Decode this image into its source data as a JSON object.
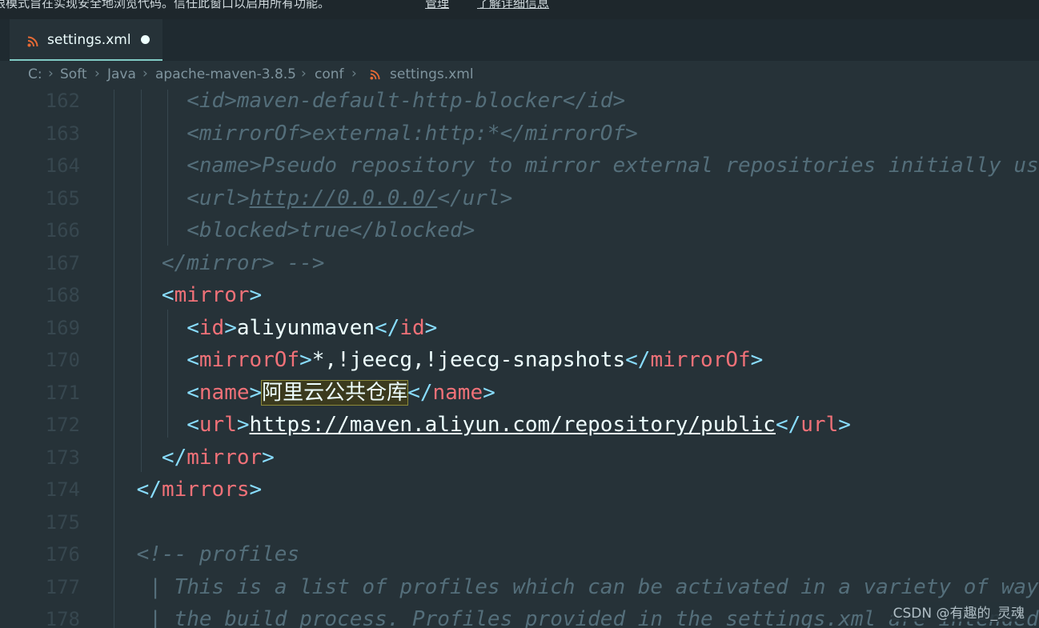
{
  "banner": {
    "message": "限模式旨在实现安全地浏览代码。信任此窗口以启用所有功能。",
    "manage_link": "管理",
    "learn_more_link": "了解详细信息"
  },
  "tab": {
    "icon": "rss-icon",
    "filename": "settings.xml",
    "modified_indicator": "unsaved-dot"
  },
  "breadcrumb": {
    "segments": [
      "C:",
      "Soft",
      "Java",
      "apache-maven-3.8.5",
      "conf",
      "settings.xml"
    ],
    "separator": "›"
  },
  "editor": {
    "line_numbers": [
      "162",
      "163",
      "164",
      "165",
      "166",
      "167",
      "168",
      "169",
      "170",
      "171",
      "172",
      "173",
      "174",
      "175",
      "176",
      "177",
      "178"
    ],
    "code": {
      "l162": {
        "indent": "        ",
        "text": "<id>maven-default-http-blocker</id>"
      },
      "l163": {
        "indent": "        ",
        "text": "<mirrorOf>external:http:*</mirrorOf>"
      },
      "l164": {
        "indent": "        ",
        "text": "<name>Pseudo repository to mirror external repositories initially using HTTP.</name>"
      },
      "l165": {
        "indent": "        ",
        "open": "<url>",
        "url": "http://0.0.0.0/",
        "close": "</url>"
      },
      "l166": {
        "indent": "        ",
        "text": "<blocked>true</blocked>"
      },
      "l167": {
        "indent": "      ",
        "text": "</mirror> -->"
      },
      "l168": {
        "indent": "      ",
        "lt": "<",
        "tag": "mirror",
        "gt": ">"
      },
      "l169": {
        "indent": "        ",
        "tag": "id",
        "value": "aliyunmaven"
      },
      "l170": {
        "indent": "        ",
        "tag": "mirrorOf",
        "value": "*,!jeecg,!jeecg-snapshots"
      },
      "l171": {
        "indent": "        ",
        "tag": "name",
        "value": "阿里云公共仓库"
      },
      "l172": {
        "indent": "        ",
        "tag": "url",
        "value": "https://maven.aliyun.com/repository/public"
      },
      "l173": {
        "indent": "      ",
        "lt": "</",
        "tag": "mirror",
        "gt": ">"
      },
      "l174": {
        "indent": "    ",
        "lt": "</",
        "tag": "mirrors",
        "gt": ">"
      },
      "l175": {
        "indent": "",
        "text": ""
      },
      "l176": {
        "indent": "    ",
        "text": "<!-- profiles"
      },
      "l177": {
        "indent": "     ",
        "text": "| This is a list of profiles which can be activated in a variety of ways, and which can modify"
      },
      "l178": {
        "indent": "     ",
        "text": "| the build process. Profiles provided in the settings.xml are intended to provide local machine-"
      }
    }
  },
  "watermark": "CSDN @有趣的_灵魂",
  "colors": {
    "background": "#263238",
    "tag": "#f07178",
    "punctuation": "#89ddff",
    "text": "#eeffff",
    "comment": "#546e7a",
    "accent": "#80cbc4",
    "rss_icon": "#e66a35"
  }
}
